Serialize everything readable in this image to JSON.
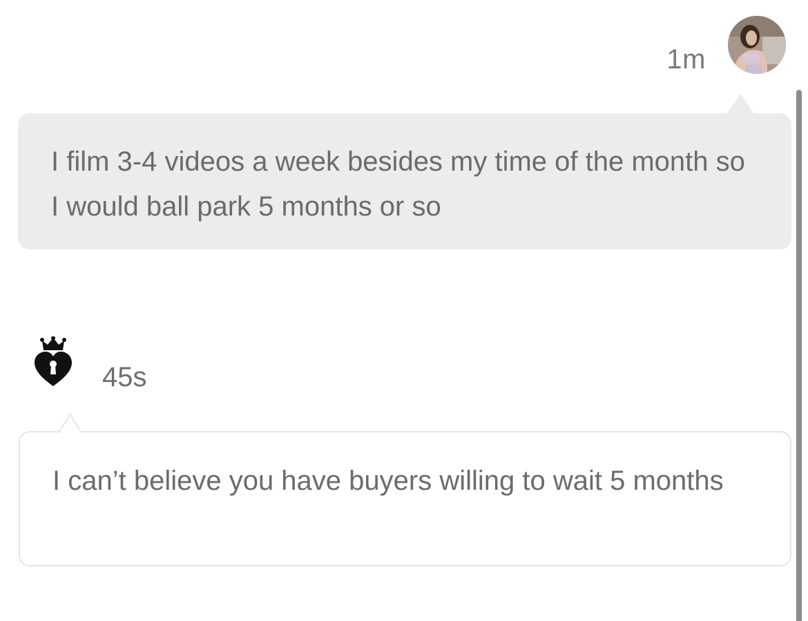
{
  "messages": [
    {
      "sender": "creator",
      "time": "1m",
      "avatar_icon": "profile-photo",
      "text": "I film 3-4 videos a week besides my time of the month so I would ball park 5 months or so",
      "bubble_color": "#ececee"
    },
    {
      "sender": "fan",
      "time": "45s",
      "avatar_icon": "crown-heart-lock-icon",
      "text": "I can’t believe you have buyers willing to wait 5 months",
      "bubble_color": "#ffffff"
    }
  ],
  "colors": {
    "text": "#6b6b6b",
    "time": "#7a7a7a",
    "bubble_received": "#ececee",
    "bubble_border_sent": "#e6e6e8",
    "scrollbar": "#8c8c8c"
  }
}
